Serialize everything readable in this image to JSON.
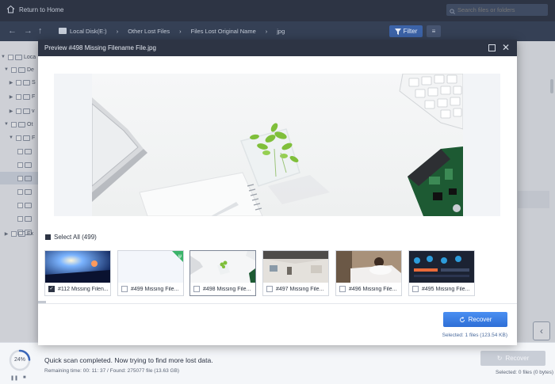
{
  "titlebar": {
    "home_label": "Return to Home"
  },
  "pathbar": {
    "crumbs": [
      "Local Disk(E:)",
      "Other Lost Files",
      "Files Lost Original Name",
      "jpg"
    ],
    "filter_label": "Filter",
    "search_placeholder": "Search files or folders"
  },
  "tree": {
    "items": [
      {
        "label": "Loca"
      },
      {
        "label": "De"
      },
      {
        "label": "S"
      },
      {
        "label": "F"
      },
      {
        "label": "v"
      },
      {
        "label": "Ot"
      },
      {
        "label": "F"
      },
      {
        "label": ""
      },
      {
        "label": ""
      },
      {
        "label": ""
      },
      {
        "label": ""
      },
      {
        "label": ""
      },
      {
        "label": ""
      },
      {
        "label": ""
      },
      {
        "label": "Ex"
      }
    ]
  },
  "modal": {
    "title": "Preview #498 Missing Filename File.jpg",
    "select_all_label": "Select All (499)",
    "thumbnails": [
      {
        "label": "#112 Missing Filen...",
        "checked": true
      },
      {
        "label": "#499 Missing File...",
        "checked": false
      },
      {
        "label": "#498 Missing File...",
        "checked": false
      },
      {
        "label": "#497 Missing File...",
        "checked": false
      },
      {
        "label": "#496 Missing File...",
        "checked": false
      },
      {
        "label": "#495 Missing File...",
        "checked": false
      }
    ],
    "recover_label": "Recover",
    "selected_info": "Selected: 1 files (123.54 KB)"
  },
  "footer": {
    "progress": "24%",
    "progress_fraction": 0.24,
    "status": "Quick scan completed. Now trying to find more lost data.",
    "meta": "Remaining time: 00: 11: 37 / Found: 275077 file (13.63 GB)",
    "recover_label": "Recover",
    "selected_info": "Selected: 0 files (0 bytes)"
  },
  "colors": {
    "titlebar": "#2d3444",
    "accent": "#2f6fd6",
    "progress_ring": "#3a66b8"
  }
}
